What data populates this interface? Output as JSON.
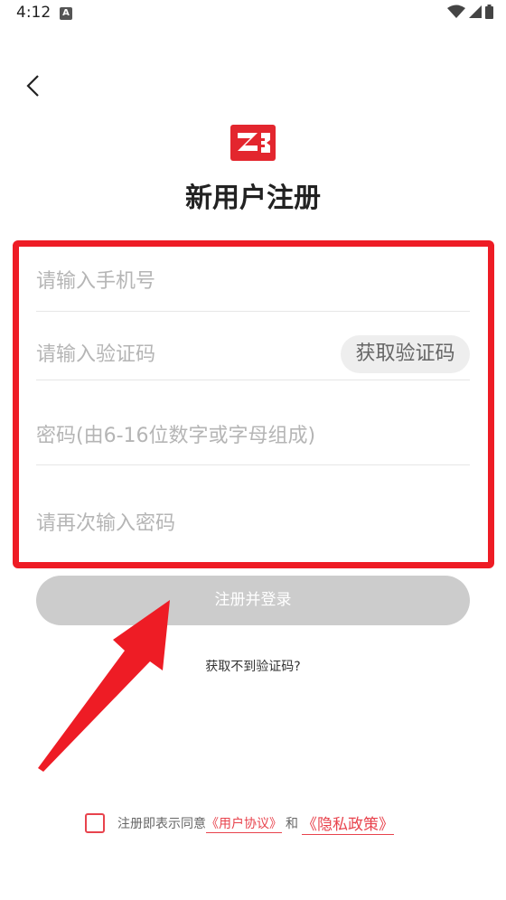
{
  "status_bar": {
    "time": "4:12",
    "notification_letter": "A"
  },
  "header": {
    "title": "新用户注册"
  },
  "form": {
    "phone_placeholder": "请输入手机号",
    "code_placeholder": "请输入验证码",
    "get_code_label": "获取验证码",
    "password_placeholder": "密码(由6-16位数字或字母组成)",
    "confirm_placeholder": "请再次输入密码"
  },
  "submit_label": "注册并登录",
  "no_code_label": "获取不到验证码?",
  "agreement": {
    "prefix": "注册即表示同意",
    "user_agreement": "《用户协议》",
    "and": "和",
    "privacy_policy": "《隐私政策》"
  },
  "colors": {
    "accent": "#ee1c25",
    "link": "#e8434d",
    "button_disabled": "#cccccc"
  }
}
